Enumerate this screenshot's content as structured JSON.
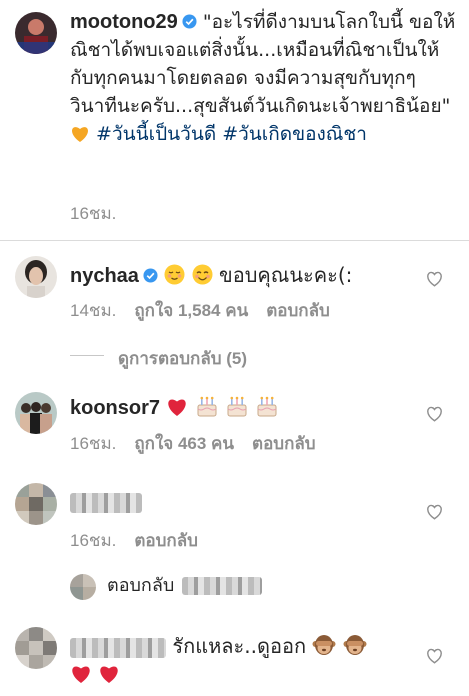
{
  "post": {
    "username": "mootono29",
    "caption": "\"อะไรที่ดีงามบนโลกใบนี้ ขอให้ณิชาได้พบเจอแต่สิ่งนั้น...เหมือนที่ณิชาเป็นให้กับทุกคนมาโดยตลอด จงมีความสุขกับทุกๆวินาทีนะครับ...สุขสันต์วันเกิดนะเจ้าพยาธิน้อย\" ",
    "hashtags": "#วันนี้เป็นวันดี #วันเกิดของณิชา",
    "time": "16ชม."
  },
  "comments": [
    {
      "username": "nychaa",
      "text": "ขอบคุณนะคะ(:",
      "time": "14ชม.",
      "likes": "ถูกใจ 1,584 คน",
      "reply": "ตอบกลับ"
    },
    {
      "username": "koonsor7",
      "time": "16ชม.",
      "likes": "ถูกใจ 463 คน",
      "reply": "ตอบกลับ"
    },
    {
      "time": "16ชม.",
      "reply": "ตอบกลับ"
    },
    {
      "text": "รักแหละ..ดูออก"
    }
  ],
  "view_replies": "ดูการตอบกลับ (5)",
  "reply_to_prefix": "ตอบกลับ",
  "colors": {
    "link": "#003569",
    "meta": "#8e8e8e",
    "verified": "#3897f0",
    "heart": "#ed4956"
  }
}
